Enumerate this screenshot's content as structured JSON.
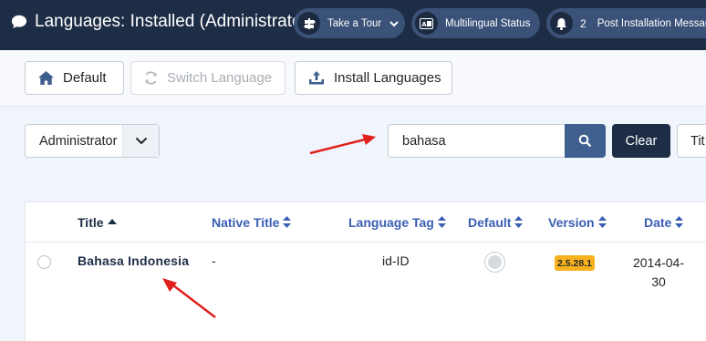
{
  "header": {
    "title": "Languages: Installed (Administrator)",
    "tour_label": "Take a Tour",
    "multilingual_label": "Multilingual Status",
    "notifications_count": "2",
    "post_install_label": "Post Installation Messages"
  },
  "toolbar": {
    "default_label": "Default",
    "switch_label": "Switch Language",
    "install_label": "Install Languages"
  },
  "filters": {
    "client_selected": "Administrator",
    "search_value": "bahasa",
    "clear_label": "Clear",
    "cut_button_label": "Tit"
  },
  "table": {
    "headers": {
      "title": "Title",
      "native_title": "Native Title",
      "language_tag": "Language Tag",
      "default": "Default",
      "version": "Version",
      "date": "Date"
    },
    "rows": [
      {
        "title": "Bahasa Indonesia",
        "native_title": "-",
        "language_tag": "id-ID",
        "version": "2.5.28.1",
        "date_line1": "2014-04-",
        "date_line2": "30"
      }
    ]
  },
  "colors": {
    "header_bg": "#1e2d46",
    "pill_bg": "#3a5178",
    "link_blue": "#3a5eb4",
    "version_badge": "#f7b21d",
    "annotation_arrow": "#e0201c"
  }
}
